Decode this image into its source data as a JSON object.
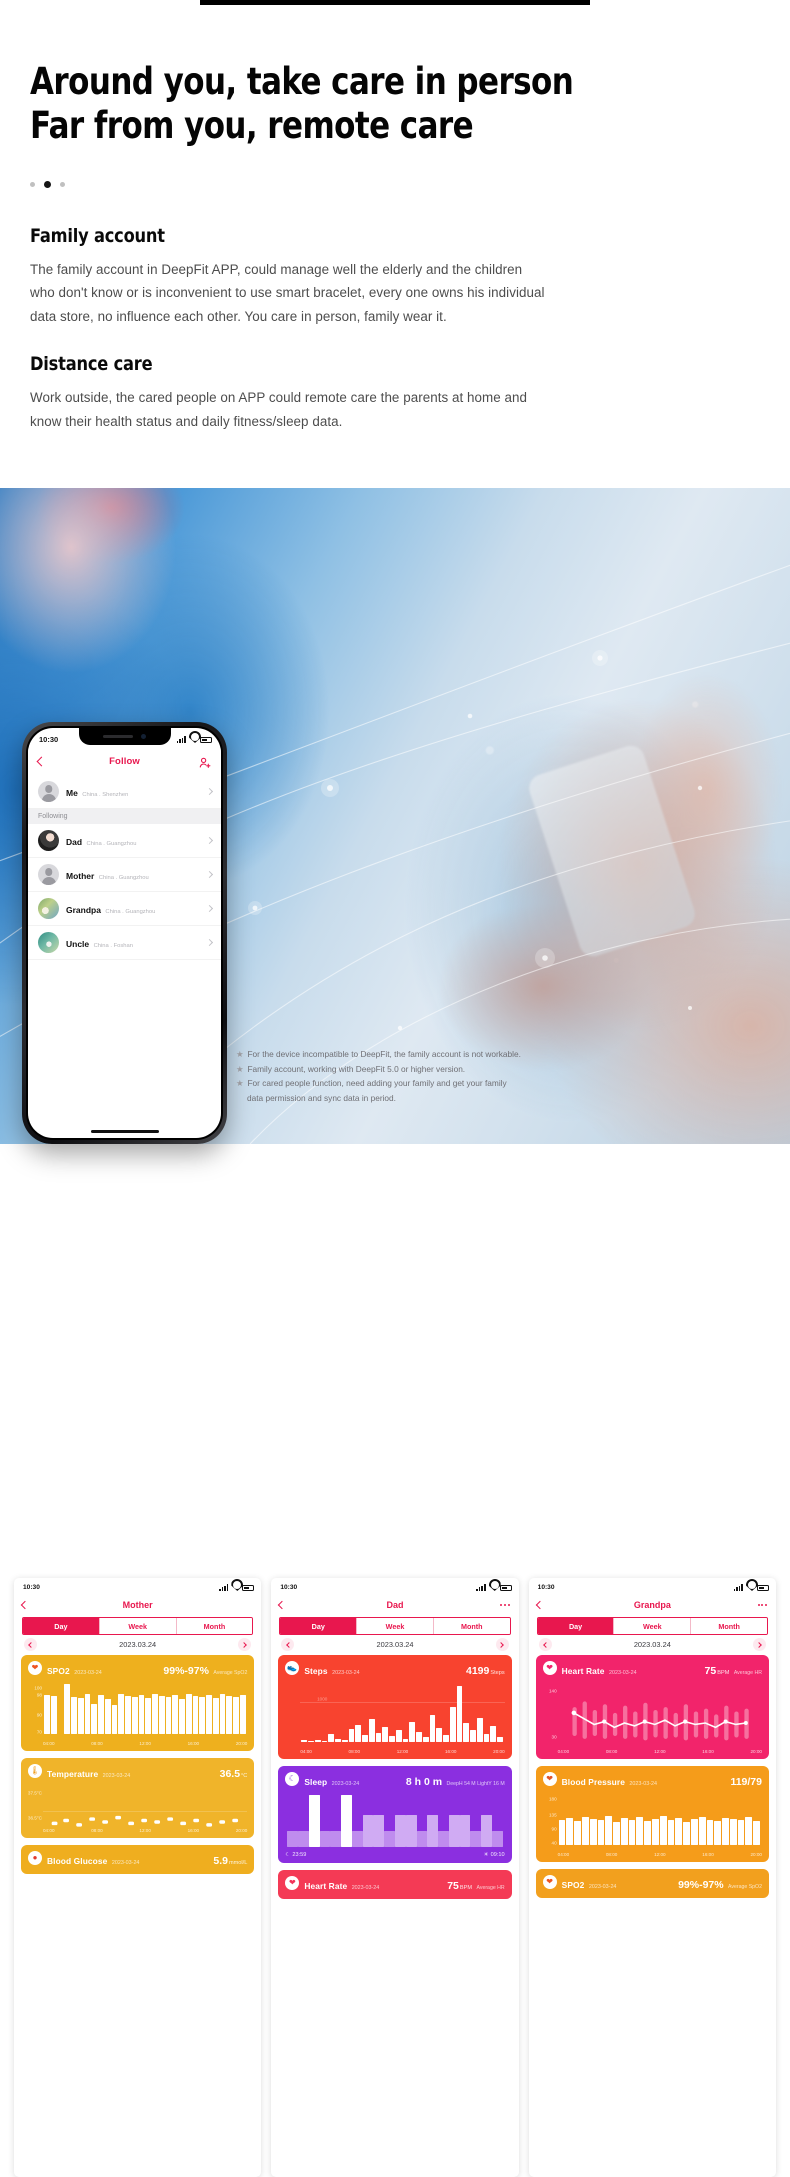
{
  "hero": {
    "headline": "Around you, take care in person\nFar from you, remote care",
    "carousel": {
      "total": 3,
      "active_index": 1
    }
  },
  "sections": [
    {
      "heading": "Family account",
      "body": "The family account in DeepFit APP, could manage well the elderly and the children who don't know or is inconvenient to use smart bracelet, every one owns his individual data store, no influence each other. You care in person, family wear it."
    },
    {
      "heading": "Distance care",
      "body": "Work outside, the cared people on APP could remote care the parents at home and know their health status and daily fitness/sleep data."
    }
  ],
  "phone_follow": {
    "status": {
      "time": "10:30"
    },
    "nav": {
      "back_icon": "chevron-left-icon",
      "title": "Follow",
      "action_icon": "add-user-icon"
    },
    "me": {
      "name": "Me",
      "location": "China . Shenzhen",
      "avatar": "default-avatar"
    },
    "section_label": "Following",
    "following": [
      {
        "name": "Dad",
        "location": "China . Guangzhou",
        "avatar": "photo-dad"
      },
      {
        "name": "Mother",
        "location": "China . Guangzhou",
        "avatar": "default-avatar"
      },
      {
        "name": "Grandpa",
        "location": "China . Guangzhou",
        "avatar": "photo-grandpa"
      },
      {
        "name": "Uncle",
        "location": "China . Foshan",
        "avatar": "photo-uncle"
      }
    ]
  },
  "notes": [
    {
      "text": "For the device incompatible to DeepFit, the family account is not workable."
    },
    {
      "text": "Family account, working with DeepFit 5.0 or higher version."
    },
    {
      "text": "For cared people function, need adding your family and get your family",
      "cont": "data permission and sync data in period."
    }
  ],
  "mini_phones": [
    {
      "status_time": "10:30",
      "title": "Mother",
      "segments": [
        "Day",
        "Week",
        "Month"
      ],
      "active_segment": "Day",
      "date": "2023.03.24",
      "cards": [
        {
          "icon": "spo2-icon",
          "title": "SPO2",
          "date": "2023-03-24",
          "value": "99%-97%",
          "unit": "Average SpO2",
          "color": "#eeb01e",
          "theme": "yellow",
          "chart": {
            "type": "bar",
            "ylabels": [
              "100",
              "98",
              "90",
              "70"
            ],
            "xlabels": [
              "04:00",
              "08:00",
              "12:00",
              "16:00",
              "20:00"
            ]
          }
        },
        {
          "icon": "temperature-icon",
          "title": "Temperature",
          "date": "2023-03-24",
          "value": "36.5",
          "value_unit": "°C",
          "unit": "",
          "color": "#f0b42a",
          "theme": "yellow2",
          "chart": {
            "type": "scatter",
            "ylabels": [
              "37.5°C",
              "36.5°C"
            ],
            "xlabels": [
              "04:00",
              "08:00",
              "12:00",
              "16:00",
              "20:00"
            ]
          }
        },
        {
          "icon": "glucose-icon",
          "title": "Blood Glucose",
          "date": "2023-03-24",
          "value": "5.9",
          "value_unit": "mmol/L",
          "unit": "",
          "color": "#efae1f",
          "theme": "yellow3",
          "chart": {
            "type": "bar",
            "ylabels": [],
            "xlabels": []
          }
        }
      ]
    },
    {
      "status_time": "10:30",
      "title": "Dad",
      "segments": [
        "Day",
        "Week",
        "Month"
      ],
      "active_segment": "Day",
      "date": "2023.03.24",
      "cards": [
        {
          "icon": "steps-icon",
          "title": "Steps",
          "date": "2023-03-24",
          "value": "4199",
          "value_unit": "Steps",
          "unit": "",
          "color": "#f8432f",
          "theme": "red",
          "chart": {
            "type": "bar",
            "ylabels": [
              "1000"
            ],
            "xlabels": [
              "04:00",
              "08:00",
              "12:00",
              "16:00",
              "20:00"
            ]
          }
        },
        {
          "icon": "sleep-icon",
          "title": "Sleep",
          "date": "2023-03-24",
          "value": "8 h 0 m",
          "unit": "DeepH 54 M  LightY 16 M",
          "color": "#8b2fe0",
          "theme": "purple",
          "chart": {
            "type": "bar",
            "ylabels": [],
            "xlabels": [
              "23:59",
              "09:10"
            ]
          },
          "foot_left": "23:59",
          "foot_right": "09:10"
        },
        {
          "icon": "heart-icon",
          "title": "Heart Rate",
          "date": "2023-03-24",
          "value": "75",
          "value_unit": "BPM",
          "unit": "Average HR",
          "color": "#f43a55",
          "theme": "red2",
          "chart": {
            "type": "line",
            "ylabels": [],
            "xlabels": []
          }
        }
      ]
    },
    {
      "status_time": "10:30",
      "title": "Grandpa",
      "segments": [
        "Day",
        "Week",
        "Month"
      ],
      "active_segment": "Day",
      "date": "2023.03.24",
      "cards": [
        {
          "icon": "heart-icon",
          "title": "Heart Rate",
          "date": "2023-03-24",
          "value": "75",
          "value_unit": "BPM",
          "unit": "Average HR",
          "color": "#f2246b",
          "theme": "pink",
          "chart": {
            "type": "line",
            "ylabels": [
              "140",
              "30"
            ],
            "xlabels": [
              "04:00",
              "08:00",
              "12:00",
              "16:00",
              "20:00"
            ]
          }
        },
        {
          "icon": "pressure-icon",
          "title": "Blood Pressure",
          "date": "2023-03-24",
          "value": "119/79",
          "unit": "",
          "color": "#f59c1a",
          "theme": "orange",
          "chart": {
            "type": "bar",
            "ylabels": [
              "180",
              "135",
              "90",
              "40"
            ],
            "xlabels": [
              "04:00",
              "08:00",
              "12:00",
              "16:00",
              "20:00"
            ]
          }
        },
        {
          "icon": "spo2-icon",
          "title": "SPO2",
          "date": "2023-03-24",
          "value": "99%-97%",
          "unit": "Average SpO2",
          "color": "#f2a01e",
          "theme": "orange2",
          "chart": {
            "type": "bar",
            "ylabels": [],
            "xlabels": []
          }
        }
      ]
    }
  ],
  "colors": {
    "accent": "#e8174e",
    "text_dark": "#0a0a0a",
    "text_body": "#4d4d4d",
    "muted": "#b4b4b9"
  }
}
